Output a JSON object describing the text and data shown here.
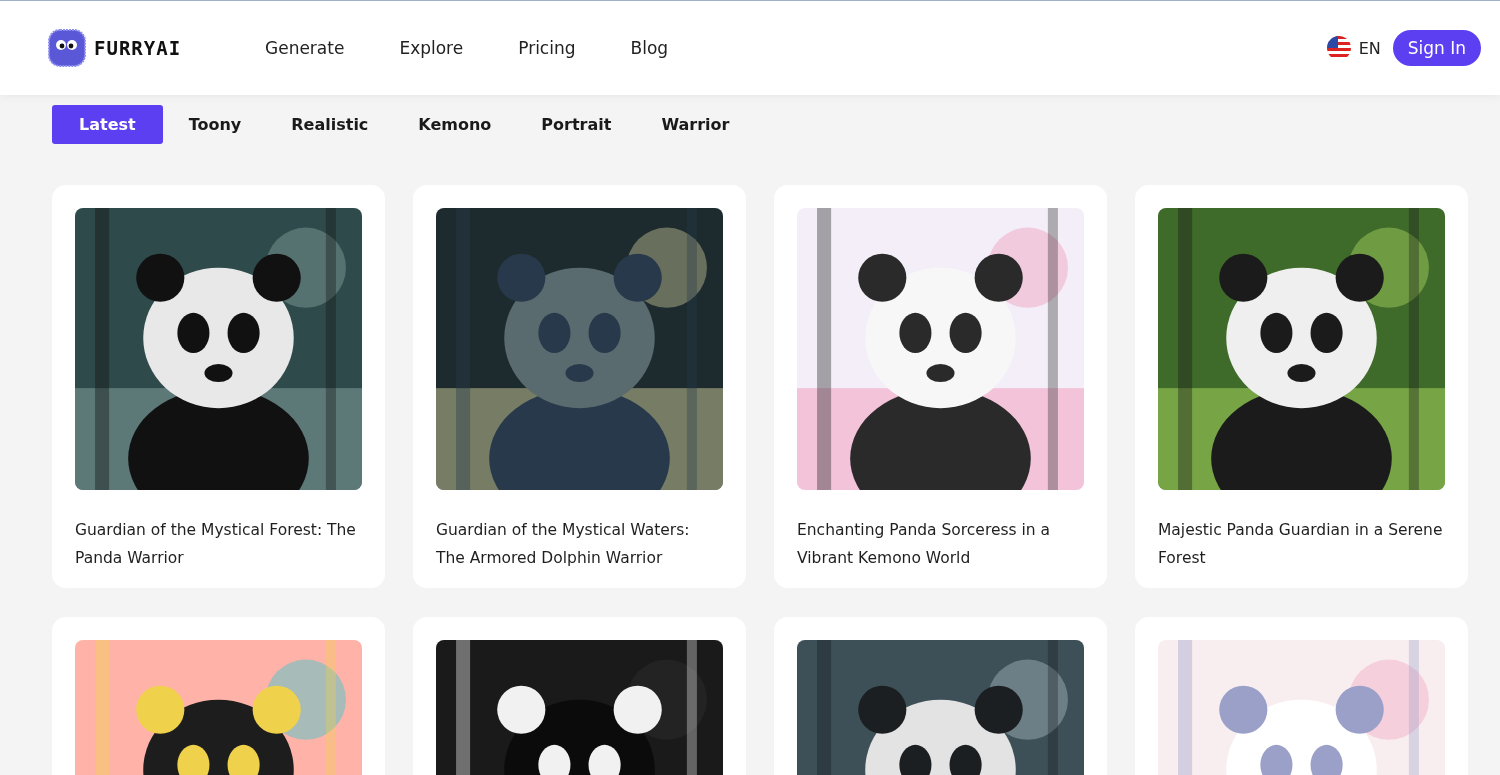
{
  "header": {
    "logo": "FURRYAI",
    "nav": [
      {
        "label": "Generate"
      },
      {
        "label": "Explore"
      },
      {
        "label": "Pricing"
      },
      {
        "label": "Blog"
      }
    ],
    "language": "EN",
    "sign_in": "Sign In"
  },
  "filters": [
    {
      "label": "Latest",
      "selected": true
    },
    {
      "label": "Toony",
      "selected": false
    },
    {
      "label": "Realistic",
      "selected": false
    },
    {
      "label": "Kemono",
      "selected": false
    },
    {
      "label": "Portrait",
      "selected": false
    },
    {
      "label": "Warrior",
      "selected": false
    }
  ],
  "cards": [
    {
      "kind": "captioned",
      "title": "Guardian of the Mystical Forest: The Panda Warrior"
    },
    {
      "kind": "captioned",
      "title": "Guardian of the Mystical Waters: The Armored Dolphin Warrior"
    },
    {
      "kind": "captioned",
      "title": "Enchanting Panda Sorceress in a Vibrant Kemono World"
    },
    {
      "kind": "captioned",
      "title": "Majestic Panda Guardian in a Serene Forest"
    },
    {
      "kind": "picture"
    },
    {
      "kind": "picture"
    },
    {
      "kind": "picture"
    },
    {
      "kind": "picture"
    }
  ]
}
